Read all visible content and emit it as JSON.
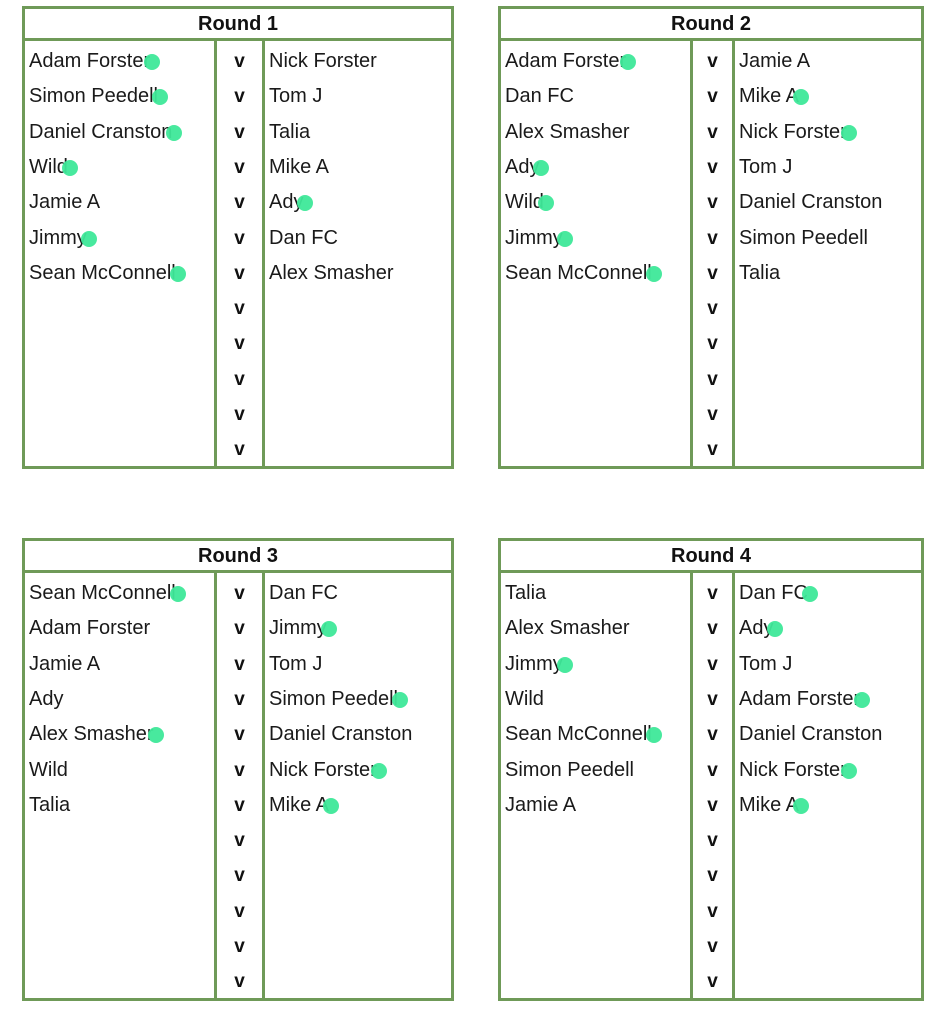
{
  "accent_colors": {
    "border": "#6f9a58",
    "marker": "#3ee899"
  },
  "versus_label": "v",
  "rows_per_round": 12,
  "rounds": [
    {
      "title": "Round 1",
      "fixtures": [
        {
          "home": "Adam Forster",
          "away": "Nick Forster"
        },
        {
          "home": "Simon Peedell",
          "away": "Tom J"
        },
        {
          "home": "Daniel Cranston",
          "away": "Talia"
        },
        {
          "home": "Wild",
          "away": "Mike A"
        },
        {
          "home": "Jamie A",
          "away": "Ady"
        },
        {
          "home": "Jimmy",
          "away": "Dan FC"
        },
        {
          "home": "Sean McConnell",
          "away": "Alex Smasher"
        },
        {
          "home": "",
          "away": ""
        },
        {
          "home": "",
          "away": ""
        },
        {
          "home": "",
          "away": ""
        },
        {
          "home": "",
          "away": ""
        },
        {
          "home": "",
          "away": ""
        }
      ]
    },
    {
      "title": "Round 2",
      "fixtures": [
        {
          "home": "Adam Forster",
          "away": "Jamie A"
        },
        {
          "home": "Dan FC",
          "away": "Mike A"
        },
        {
          "home": "Alex Smasher",
          "away": "Nick Forster"
        },
        {
          "home": "Ady",
          "away": "Tom J"
        },
        {
          "home": "Wild",
          "away": "Daniel Cranston"
        },
        {
          "home": "Jimmy",
          "away": "Simon Peedell"
        },
        {
          "home": "Sean McConnell",
          "away": "Talia"
        },
        {
          "home": "",
          "away": ""
        },
        {
          "home": "",
          "away": ""
        },
        {
          "home": "",
          "away": ""
        },
        {
          "home": "",
          "away": ""
        },
        {
          "home": "",
          "away": ""
        }
      ]
    },
    {
      "title": "Round 3",
      "fixtures": [
        {
          "home": "Sean McConnell",
          "away": "Dan FC"
        },
        {
          "home": "Adam Forster",
          "away": "Jimmy"
        },
        {
          "home": "Jamie A",
          "away": "Tom J"
        },
        {
          "home": "Ady",
          "away": "Simon Peedell"
        },
        {
          "home": "Alex Smasher",
          "away": "Daniel Cranston"
        },
        {
          "home": "Wild",
          "away": "Nick Forster"
        },
        {
          "home": "Talia",
          "away": "Mike A"
        },
        {
          "home": "",
          "away": ""
        },
        {
          "home": "",
          "away": ""
        },
        {
          "home": "",
          "away": ""
        },
        {
          "home": "",
          "away": ""
        },
        {
          "home": "",
          "away": ""
        }
      ]
    },
    {
      "title": "Round 4",
      "fixtures": [
        {
          "home": "Talia",
          "away": "Dan FC"
        },
        {
          "home": "Alex Smasher",
          "away": "Ady"
        },
        {
          "home": "Jimmy",
          "away": "Tom J"
        },
        {
          "home": "Wild",
          "away": "Adam Forster"
        },
        {
          "home": "Sean McConnell",
          "away": "Daniel Cranston"
        },
        {
          "home": "Simon Peedell",
          "away": "Nick Forster"
        },
        {
          "home": "Jamie A",
          "away": "Mike A"
        },
        {
          "home": "",
          "away": ""
        },
        {
          "home": "",
          "away": ""
        },
        {
          "home": "",
          "away": ""
        },
        {
          "home": "",
          "away": ""
        },
        {
          "home": "",
          "away": ""
        }
      ]
    }
  ],
  "markers": [
    {
      "round": 0,
      "row": 0,
      "side": "home"
    },
    {
      "round": 0,
      "row": 1,
      "side": "home"
    },
    {
      "round": 0,
      "row": 2,
      "side": "home"
    },
    {
      "round": 0,
      "row": 3,
      "side": "home"
    },
    {
      "round": 0,
      "row": 4,
      "side": "away"
    },
    {
      "round": 0,
      "row": 5,
      "side": "home"
    },
    {
      "round": 0,
      "row": 6,
      "side": "home"
    },
    {
      "round": 1,
      "row": 0,
      "side": "home"
    },
    {
      "round": 1,
      "row": 1,
      "side": "away"
    },
    {
      "round": 1,
      "row": 2,
      "side": "away"
    },
    {
      "round": 1,
      "row": 3,
      "side": "home"
    },
    {
      "round": 1,
      "row": 4,
      "side": "home"
    },
    {
      "round": 1,
      "row": 5,
      "side": "home"
    },
    {
      "round": 1,
      "row": 6,
      "side": "home"
    },
    {
      "round": 2,
      "row": 0,
      "side": "home"
    },
    {
      "round": 2,
      "row": 1,
      "side": "away"
    },
    {
      "round": 2,
      "row": 3,
      "side": "away"
    },
    {
      "round": 2,
      "row": 4,
      "side": "home"
    },
    {
      "round": 2,
      "row": 5,
      "side": "away"
    },
    {
      "round": 2,
      "row": 6,
      "side": "away"
    },
    {
      "round": 3,
      "row": 0,
      "side": "away"
    },
    {
      "round": 3,
      "row": 1,
      "side": "away"
    },
    {
      "round": 3,
      "row": 2,
      "side": "home"
    },
    {
      "round": 3,
      "row": 3,
      "side": "away"
    },
    {
      "round": 3,
      "row": 4,
      "side": "home"
    },
    {
      "round": 3,
      "row": 5,
      "side": "away"
    },
    {
      "round": 3,
      "row": 6,
      "side": "away"
    }
  ]
}
